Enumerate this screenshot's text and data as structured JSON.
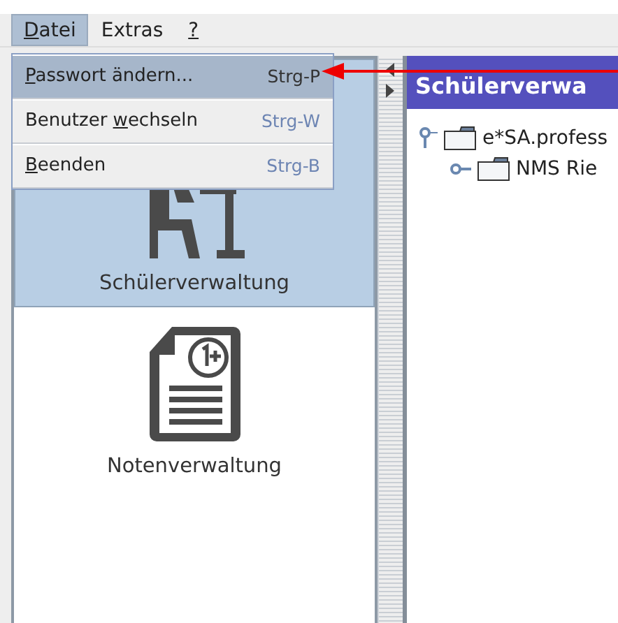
{
  "menu_bar": [
    {
      "label": {
        "underlined": "D",
        "after": "atei"
      },
      "selected": true
    },
    {
      "label": {
        "before": "Extras"
      },
      "selected": false
    },
    {
      "label": {
        "underlined": "?"
      },
      "selected": false
    }
  ],
  "open_menu": [
    {
      "label": {
        "underlined": "P",
        "after": "asswort ändern..."
      },
      "shortcut": "Strg-P",
      "selected": true
    },
    {
      "label": {
        "before": "Benutzer ",
        "underlined": "w",
        "after": "echseln"
      },
      "shortcut": "Strg-W",
      "selected": false
    },
    {
      "label": {
        "underlined": "B",
        "after": "eenden"
      },
      "shortcut": "Strg-B",
      "selected": false
    }
  ],
  "modules": [
    {
      "label": "Schülerverwaltung",
      "kind": "students",
      "selected": true
    },
    {
      "label": "Notenverwaltung",
      "kind": "grades",
      "selected": false
    }
  ],
  "panel_title": "Schülerverwa",
  "tree": [
    {
      "label": "e*SA.profess",
      "expanded": true,
      "children": [
        {
          "label": "NMS Rie",
          "expanded": false
        }
      ]
    }
  ]
}
